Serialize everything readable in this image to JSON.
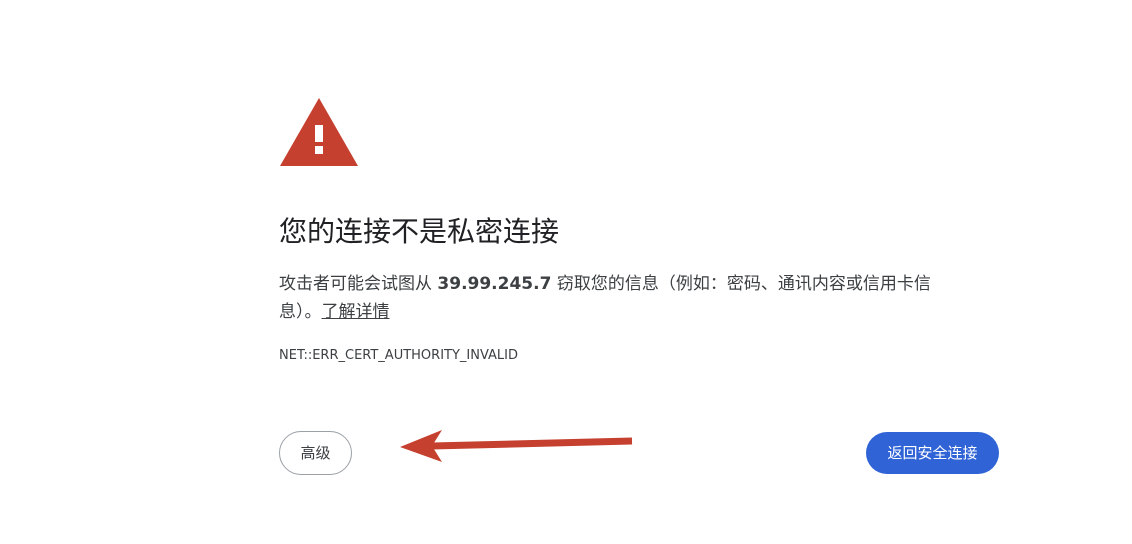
{
  "interstitial": {
    "icon": "warning-triangle-icon",
    "icon_color": "#c5402f",
    "headline": "您的连接不是私密连接",
    "description_prefix": "攻击者可能会试图从 ",
    "host": "39.99.245.7",
    "description_suffix": " 窃取您的信息（例如：密码、通讯内容或信用卡信息）。",
    "learn_more_label": "了解详情",
    "error_code": "NET::ERR_CERT_AUTHORITY_INVALID"
  },
  "actions": {
    "advanced_label": "高级",
    "back_to_safety_label": "返回安全连接",
    "primary_color": "#2f63d6"
  },
  "annotation": {
    "shape": "arrow",
    "points_to": "advanced-button",
    "color": "#c5402f"
  }
}
